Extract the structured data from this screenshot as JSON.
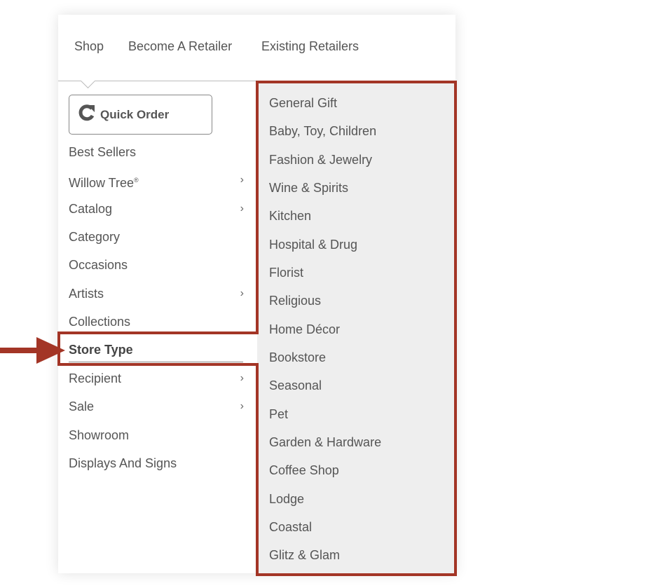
{
  "top_nav": {
    "items": [
      "Shop",
      "Become A Retailer",
      "Existing Retailers"
    ]
  },
  "quick_order": {
    "label": "Quick Order",
    "icon": "refresh-arrow-icon"
  },
  "left_menu": {
    "items": [
      {
        "label": "Best Sellers",
        "has_submenu": false
      },
      {
        "label": "Willow Tree",
        "superscript": "®",
        "has_submenu": true
      },
      {
        "label": "Catalog",
        "has_submenu": true
      },
      {
        "label": "Category",
        "has_submenu": false
      },
      {
        "label": "Occasions",
        "has_submenu": false
      },
      {
        "label": "Artists",
        "has_submenu": true
      },
      {
        "label": "Collections",
        "has_submenu": false
      },
      {
        "label": "Store Type",
        "has_submenu": false,
        "active": true
      },
      {
        "label": "Recipient",
        "has_submenu": true
      },
      {
        "label": "Sale",
        "has_submenu": true
      },
      {
        "label": "Showroom",
        "has_submenu": false
      },
      {
        "label": "Displays And Signs",
        "has_submenu": false
      }
    ],
    "chevron": "›"
  },
  "store_type_submenu": {
    "items": [
      "General Gift",
      "Baby, Toy, Children",
      "Fashion & Jewelry",
      "Wine & Spirits",
      "Kitchen",
      "Hospital & Drug",
      "Florist",
      "Religious",
      "Home Décor",
      "Bookstore",
      "Seasonal",
      "Pet",
      "Garden & Hardware",
      "Coffee Shop",
      "Lodge",
      "Coastal",
      "Glitz & Glam"
    ]
  },
  "colors": {
    "annotation": "#a33526",
    "submenu_bg": "#eeeeee",
    "text": "#555555"
  }
}
